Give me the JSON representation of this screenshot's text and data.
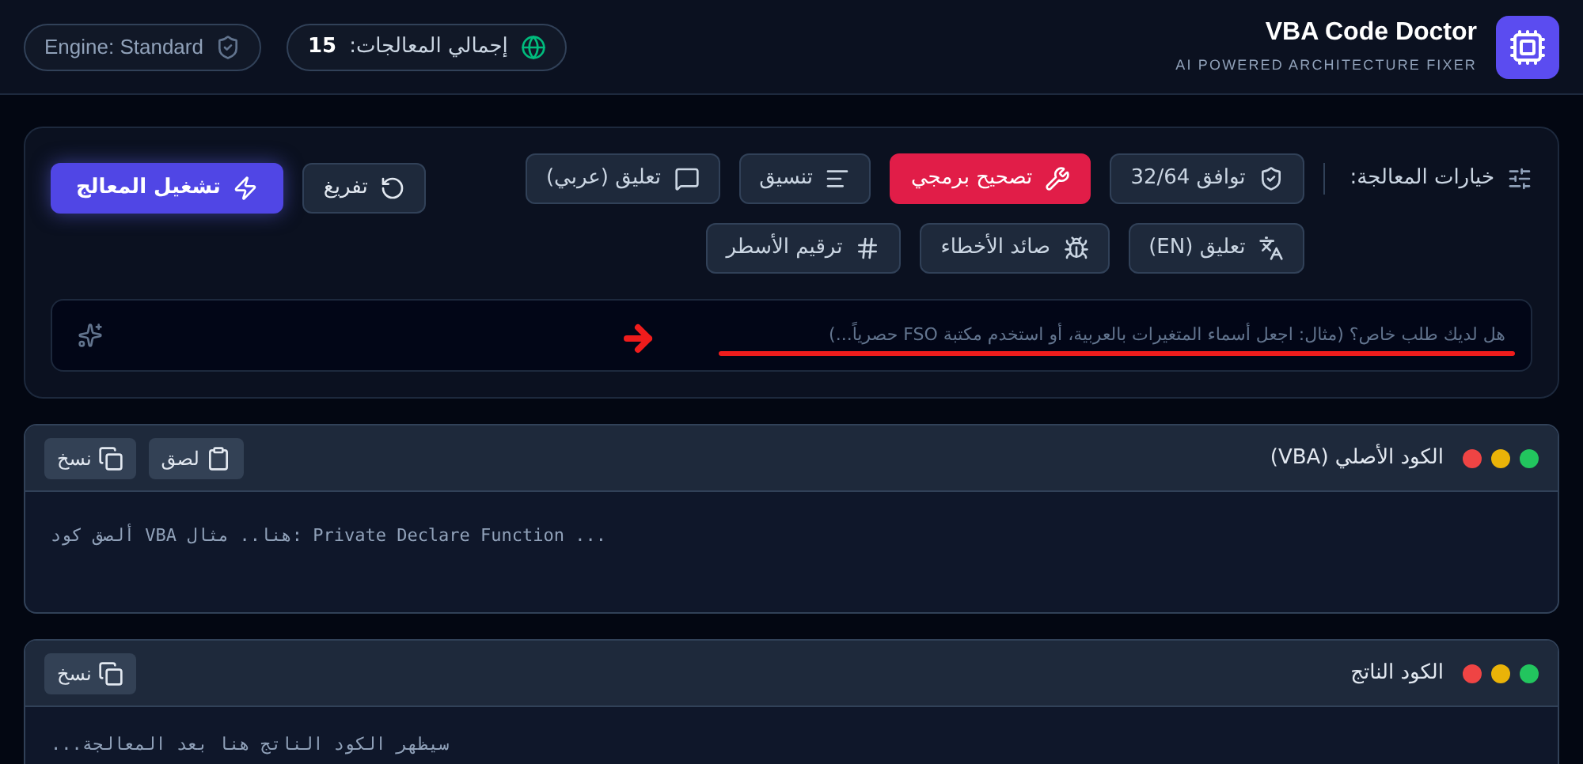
{
  "header": {
    "title": "VBA Code Doctor",
    "subtitle": "AI POWERED ARCHITECTURE FIXER",
    "stats": {
      "label": "إجمالي المعالجات:",
      "count": "15"
    },
    "engine": "Engine: Standard"
  },
  "options": {
    "label": "خيارات المعالجة:",
    "items": [
      {
        "label": "توافق 32/64",
        "kind": "shield",
        "selected": false
      },
      {
        "label": "تصحيح برمجي",
        "kind": "wrench",
        "selected": true
      },
      {
        "label": "تنسيق",
        "kind": "align",
        "selected": false
      },
      {
        "label": "تعليق (عربي)",
        "kind": "comment",
        "selected": false
      },
      {
        "label": "تعليق (EN)",
        "kind": "translate",
        "selected": false
      },
      {
        "label": "صائد الأخطاء",
        "kind": "bug",
        "selected": false
      },
      {
        "label": "ترقيم الأسطر",
        "kind": "hash",
        "selected": false
      }
    ],
    "clear": "تفريغ",
    "run": "تشغيل المعالج",
    "request": {
      "placeholder": "هل لديك طلب خاص؟ (مثال: اجعل أسماء المتغيرات بالعربية، أو استخدم مكتبة FSO حصرياً...)"
    }
  },
  "panels": [
    {
      "title": "الكود الأصلي (VBA)",
      "dots": [
        {
          "color": "#22c55e"
        },
        {
          "color": "#eab308"
        },
        {
          "color": "#ef4444"
        }
      ],
      "actions": [
        {
          "label": "لصق",
          "kind": "paste"
        },
        {
          "label": "نسخ",
          "kind": "copy"
        }
      ],
      "placeholder": "ألصق كود VBA هنا.. مثال: Private Declare Function ..."
    },
    {
      "title": "الكود الناتج",
      "dots": [
        {
          "color": "#22c55e"
        },
        {
          "color": "#eab308"
        },
        {
          "color": "#ef4444"
        }
      ],
      "actions": [
        {
          "label": "نسخ",
          "kind": "copy"
        }
      ],
      "placeholder": "...سيظهر الكود الناتج هنا بعد المعالجة"
    }
  ]
}
